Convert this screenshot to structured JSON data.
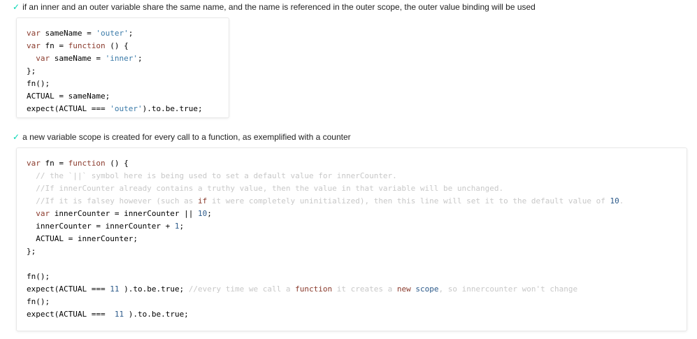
{
  "tests": [
    {
      "check": "✓",
      "title": "if an inner and an outer variable share the same name, and the name is referenced in the outer scope, the outer value binding will be used",
      "code": [
        [
          {
            "t": "var",
            "c": "kw"
          },
          {
            "t": " sameName = "
          },
          {
            "t": "'outer'",
            "c": "str"
          },
          {
            "t": ";"
          }
        ],
        [
          {
            "t": "var",
            "c": "kw"
          },
          {
            "t": " fn = "
          },
          {
            "t": "function",
            "c": "kw"
          },
          {
            "t": " () {"
          }
        ],
        [
          {
            "t": "  "
          },
          {
            "t": "var",
            "c": "kw"
          },
          {
            "t": " sameName = "
          },
          {
            "t": "'inner'",
            "c": "str"
          },
          {
            "t": ";"
          }
        ],
        [
          {
            "t": "};"
          }
        ],
        [
          {
            "t": "fn();"
          }
        ],
        [
          {
            "t": "ACTUAL = sameName;"
          }
        ],
        [
          {
            "t": "expect(ACTUAL === "
          },
          {
            "t": "'outer'",
            "c": "str"
          },
          {
            "t": ").to.be.true;"
          }
        ]
      ]
    },
    {
      "check": "✓",
      "title": "a new variable scope is created for every call to a function, as exemplified with a counter",
      "code": [
        [
          {
            "t": "var",
            "c": "kw"
          },
          {
            "t": " fn = "
          },
          {
            "t": "function",
            "c": "kw"
          },
          {
            "t": " () {"
          }
        ],
        [
          {
            "t": "  // the `||` symbol here is being used to set a default value for innerCounter.",
            "c": "cm"
          }
        ],
        [
          {
            "t": "  //If innerCounter already contains a truthy value, then the value in that variable will be unchanged.",
            "c": "cm"
          }
        ],
        [
          {
            "t": "  //If it is falsey however (such as ",
            "c": "cm"
          },
          {
            "t": "if",
            "c": "cm-kw"
          },
          {
            "t": " it were completely uninitialized), then this line will set it to the default value of ",
            "c": "cm"
          },
          {
            "t": "10",
            "c": "num"
          },
          {
            "t": ".",
            "c": "cm"
          }
        ],
        [
          {
            "t": "  "
          },
          {
            "t": "var",
            "c": "kw"
          },
          {
            "t": " innerCounter = innerCounter || "
          },
          {
            "t": "10",
            "c": "num"
          },
          {
            "t": ";"
          }
        ],
        [
          {
            "t": "  innerCounter = innerCounter + "
          },
          {
            "t": "1",
            "c": "num"
          },
          {
            "t": ";"
          }
        ],
        [
          {
            "t": "  ACTUAL = innerCounter;"
          }
        ],
        [
          {
            "t": "};"
          }
        ],
        [
          {
            "t": ""
          }
        ],
        [
          {
            "t": "fn();"
          }
        ],
        [
          {
            "t": "expect(ACTUAL === "
          },
          {
            "t": "11",
            "c": "num"
          },
          {
            "t": " ).to.be.true; "
          },
          {
            "t": "//every time we call a ",
            "c": "cm"
          },
          {
            "t": "function",
            "c": "cm-kw"
          },
          {
            "t": " it creates a ",
            "c": "cm"
          },
          {
            "t": "new",
            "c": "cm-kw"
          },
          {
            "t": " ",
            "c": "cm"
          },
          {
            "t": "scope",
            "c": "num"
          },
          {
            "t": ", so innercounter won't change",
            "c": "cm"
          }
        ],
        [
          {
            "t": "fn();"
          }
        ],
        [
          {
            "t": "expect(ACTUAL ===  "
          },
          {
            "t": "11",
            "c": "num"
          },
          {
            "t": " ).to.be.true;"
          }
        ]
      ]
    }
  ]
}
